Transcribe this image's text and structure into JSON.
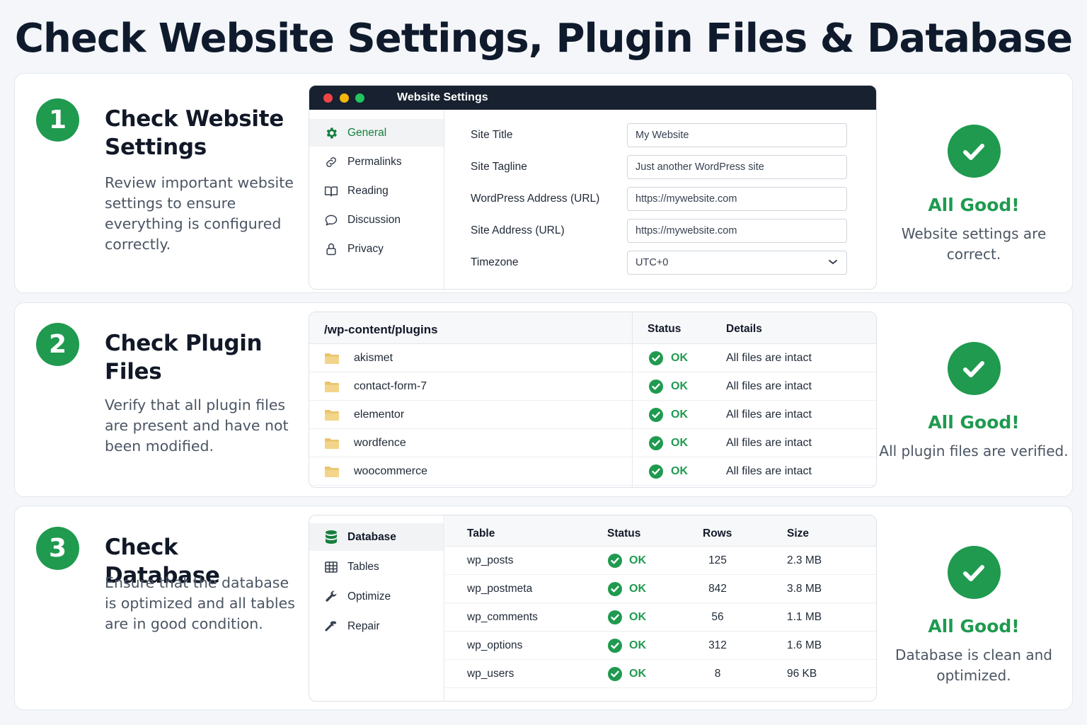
{
  "title": "Check Website Settings, Plugin Files & Database",
  "colors": {
    "accent": "#1f9a4f",
    "window_bar": "#17212f",
    "folder": "#e9c46a"
  },
  "sections": [
    {
      "number": "1",
      "title": "Check Website Settings",
      "description": "Review important website settings to ensure everything is configured correctly.",
      "result_title": "All Good!",
      "result_desc": "Website settings are correct."
    },
    {
      "number": "2",
      "title": "Check Plugin Files",
      "description": "Verify that all plugin files are present and have not been modified.",
      "result_title": "All Good!",
      "result_desc": "All plugin files are verified."
    },
    {
      "number": "3",
      "title": "Check Database",
      "description": "Ensure that the database is optimized and all tables are in good condition.",
      "result_title": "All Good!",
      "result_desc": "Database is clean and optimized."
    }
  ],
  "settings_window": {
    "title": "Website Settings",
    "nav": [
      {
        "label": "General",
        "icon": "gear-icon",
        "active": true
      },
      {
        "label": "Permalinks",
        "icon": "link-icon"
      },
      {
        "label": "Reading",
        "icon": "book-icon"
      },
      {
        "label": "Discussion",
        "icon": "chat-bubble-icon"
      },
      {
        "label": "Privacy",
        "icon": "lock-icon"
      }
    ],
    "fields": [
      {
        "label": "Site Title",
        "value": "My Website"
      },
      {
        "label": "Site Tagline",
        "value": "Just another WordPress site"
      },
      {
        "label": "WordPress Address (URL)",
        "value": "https://mywebsite.com"
      },
      {
        "label": "Site Address (URL)",
        "value": "https://mywebsite.com"
      },
      {
        "label": "Timezone",
        "value": "UTC+0"
      }
    ]
  },
  "plugins_table": {
    "path": "/wp-content/plugins",
    "status_header": "Status",
    "details_header": "Details",
    "rows": [
      {
        "name": "akismet",
        "status": "OK",
        "details": "All files are intact"
      },
      {
        "name": "contact-form-7",
        "status": "OK",
        "details": "All files are intact"
      },
      {
        "name": "elementor",
        "status": "OK",
        "details": "All files are intact"
      },
      {
        "name": "wordfence",
        "status": "OK",
        "details": "All files are intact"
      },
      {
        "name": "woocommerce",
        "status": "OK",
        "details": "All files are intact"
      }
    ]
  },
  "database_panel": {
    "nav": [
      {
        "label": "Database",
        "icon": "database-icon",
        "active": true
      },
      {
        "label": "Tables",
        "icon": "table-grid-icon"
      },
      {
        "label": "Optimize",
        "icon": "wrench-icon"
      },
      {
        "label": "Repair",
        "icon": "hammer-icon"
      }
    ],
    "headers": {
      "table": "Table",
      "status": "Status",
      "rows": "Rows",
      "size": "Size"
    },
    "rows": [
      {
        "table": "wp_posts",
        "status": "OK",
        "rows": "125",
        "size": "2.3 MB"
      },
      {
        "table": "wp_postmeta",
        "status": "OK",
        "rows": "842",
        "size": "3.8 MB"
      },
      {
        "table": "wp_comments",
        "status": "OK",
        "rows": "56",
        "size": "1.1 MB"
      },
      {
        "table": "wp_options",
        "status": "OK",
        "rows": "312",
        "size": "1.6 MB"
      },
      {
        "table": "wp_users",
        "status": "OK",
        "rows": "8",
        "size": "96 KB"
      }
    ]
  }
}
